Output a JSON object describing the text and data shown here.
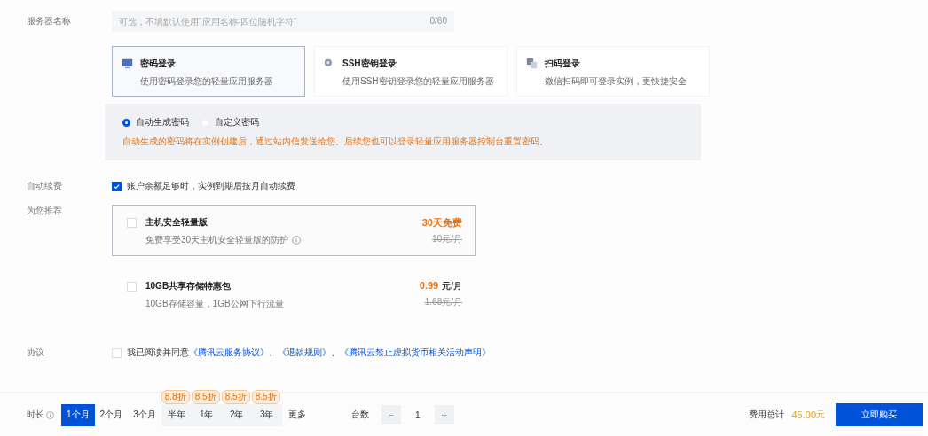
{
  "server_name": {
    "label": "服务器名称",
    "placeholder": "可选，不填默认使用\"应用名称-四位随机字符\"",
    "counter": "0/60"
  },
  "login_methods": [
    {
      "kind": "password",
      "title": "密码登录",
      "description": "使用密码登录您的轻量应用服务器",
      "selected": true
    },
    {
      "kind": "ssh",
      "title": "SSH密钥登录",
      "description": "使用SSH密钥登录您的轻量应用服务器",
      "selected": false
    },
    {
      "kind": "qrcode",
      "title": "扫码登录",
      "description": "微信扫码即可登录实例，更快捷安全",
      "selected": false
    }
  ],
  "password": {
    "options": [
      {
        "label": "自动生成密码",
        "selected": true
      },
      {
        "label": "自定义密码",
        "selected": false
      }
    ],
    "hint": "自动生成的密码将在实例创建后，通过站内信发送给您。后续您也可以登录轻量应用服务器控制台重置密码。"
  },
  "auto_renew": {
    "label": "自动续费",
    "checked": true,
    "text": "账户余额足够时，实例到期后按月自动续费"
  },
  "recommend": {
    "label": "为您推荐",
    "items": [
      {
        "title": "主机安全轻量版",
        "description": "免费享受30天主机安全轻量版的防护",
        "info": true,
        "price": "30天免费",
        "original_price": "10元/月",
        "checked": false,
        "highlighted": true
      },
      {
        "title": "10GB共享存储特惠包",
        "description": "10GB存储容量，1GB公网下行流量",
        "info": false,
        "price": "0.99",
        "unit": "元/月",
        "original_price": "1.68元/月",
        "checked": false,
        "highlighted": false
      }
    ]
  },
  "agreement": {
    "label": "协议",
    "checked": false,
    "parts": [
      {
        "kind": "text",
        "text": "我已阅读并同意"
      },
      {
        "kind": "link",
        "text": "《腾讯云服务协议》"
      },
      {
        "kind": "text",
        "text": "、"
      },
      {
        "kind": "link",
        "text": "《退款规则》"
      },
      {
        "kind": "text",
        "text": "、"
      },
      {
        "kind": "link",
        "text": "《腾讯云禁止虚拟货币相关活动声明》"
      }
    ]
  },
  "footer": {
    "duration_label": "时长",
    "durations": [
      {
        "label": "1个月",
        "selected": true
      },
      {
        "label": "2个月",
        "selected": false
      },
      {
        "label": "3个月",
        "selected": false
      },
      {
        "label": "半年",
        "badge": "8.8折",
        "selected": false
      },
      {
        "label": "1年",
        "badge": "8.5折",
        "selected": false
      },
      {
        "label": "2年",
        "badge": "8.5折",
        "selected": false
      },
      {
        "label": "3年",
        "badge": "8.5折",
        "selected": false
      },
      {
        "label": "更多",
        "selected": false
      }
    ],
    "quantity_label": "台数",
    "decrement": "−",
    "quantity": "1",
    "increment": "+",
    "total_label": "费用总计",
    "total": "45.00",
    "currency": "元",
    "buy_button": "立即购买"
  }
}
